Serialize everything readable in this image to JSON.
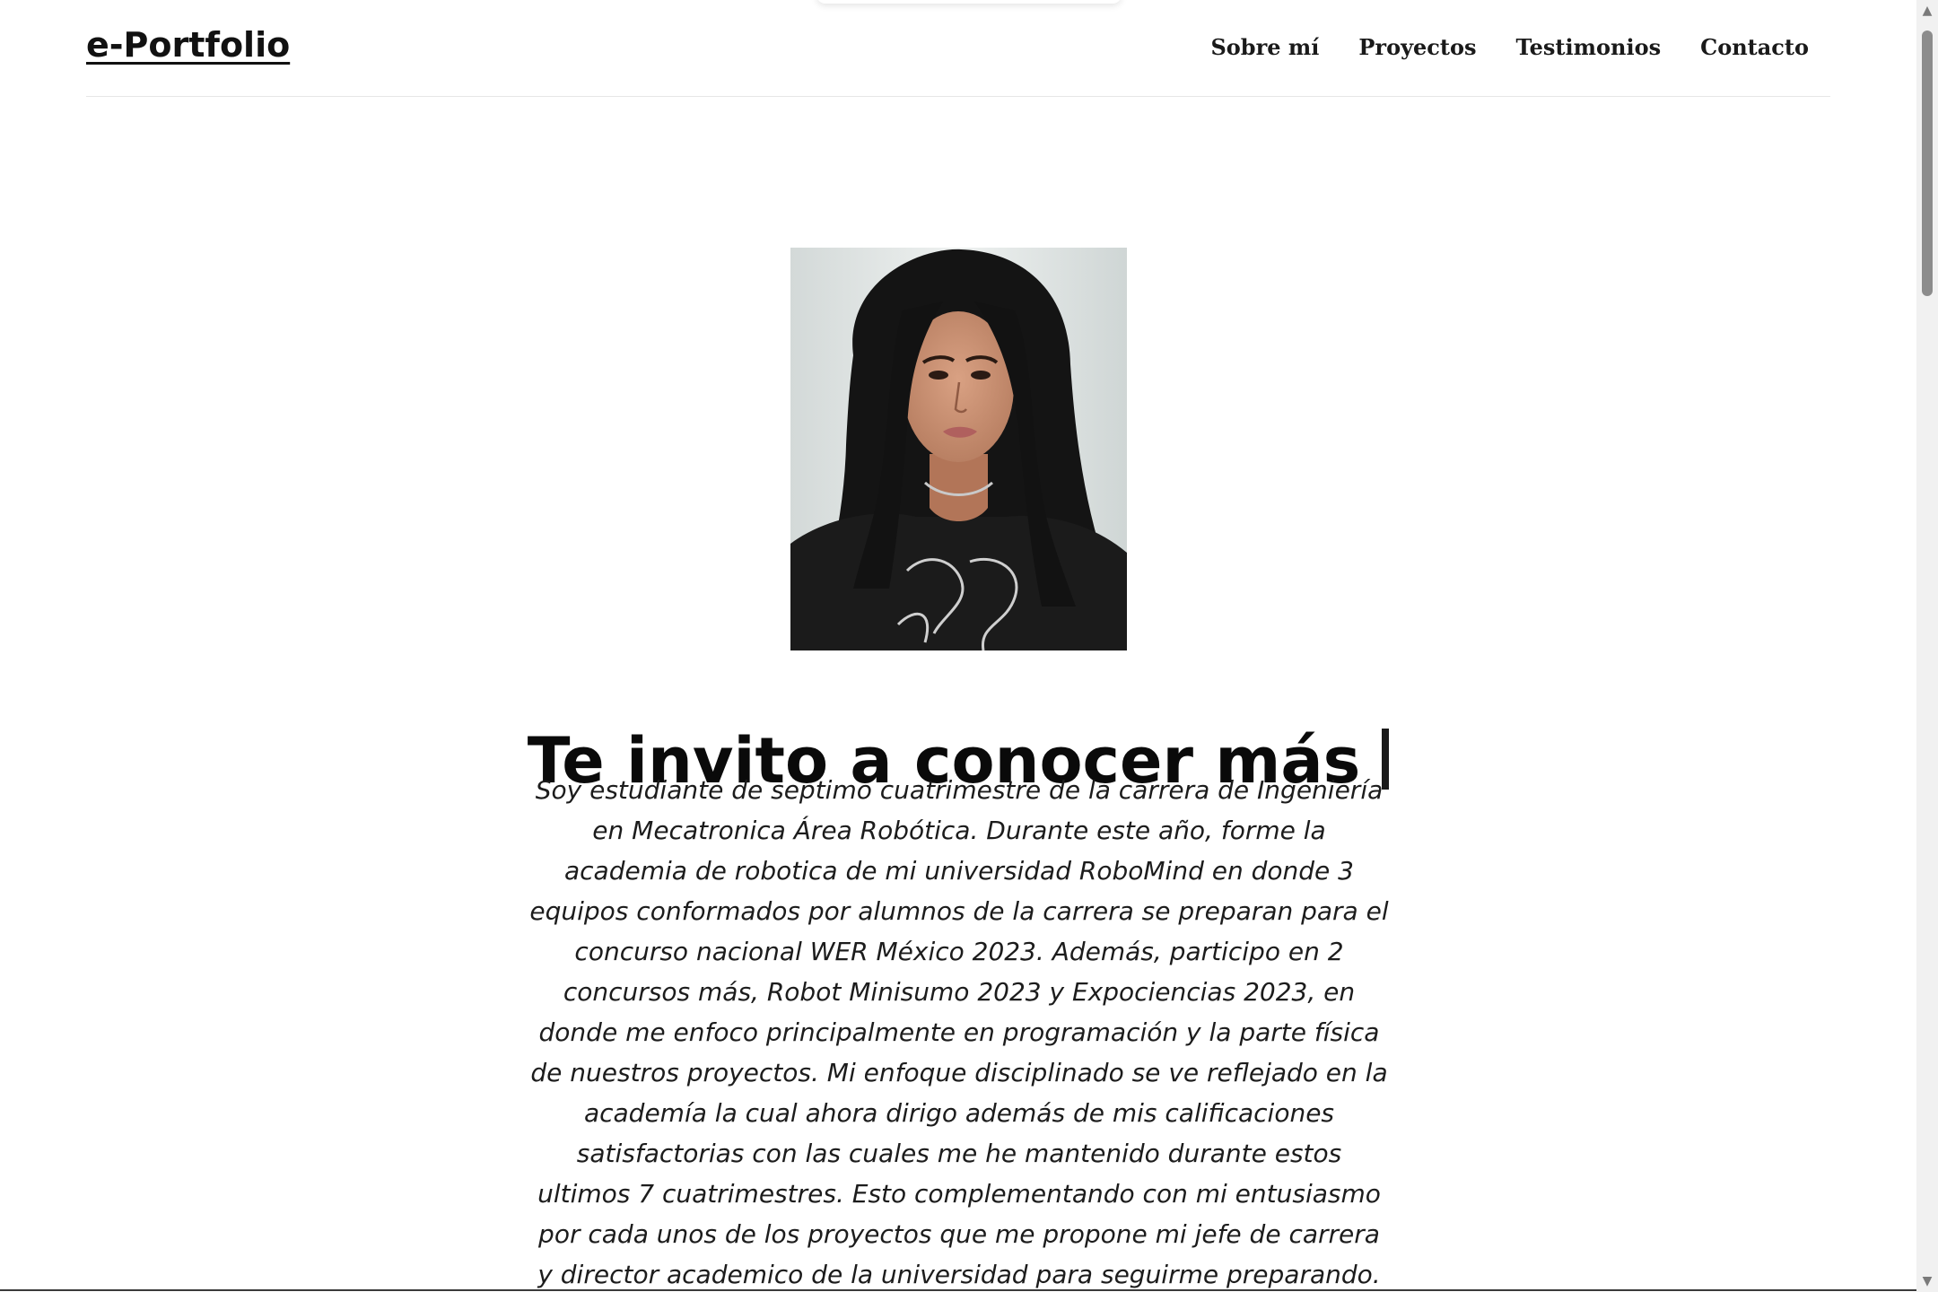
{
  "header": {
    "brand": "e-Portfolio",
    "nav": [
      {
        "label": "Sobre mí"
      },
      {
        "label": "Proyectos"
      },
      {
        "label": "Testimonios"
      },
      {
        "label": "Contacto"
      }
    ]
  },
  "hero": {
    "photo_icon": "profile-photo",
    "headline": "Te invito a conocer más",
    "bio": "Soy estudiante de septimo cuatrimestre de la carrera de Ingeniería en Mecatronica Área Robótica. Durante este año, forme la academia de robotica de mi universidad RoboMind en donde 3 equipos conformados por alumnos de la carrera se preparan para el concurso nacional WER México 2023. Además, participo en 2 concursos más, Robot Minisumo 2023 y Expociencias 2023, en donde me enfoco principalmente en programación y la parte física de nuestros proyectos. Mi enfoque disciplinado se ve reflejado en la academía la cual ahora dirigo además de mis calificaciones satisfactorias con las cuales me he mantenido durante estos ultimos 7 cuatrimestres. Esto complementando con mi entusiasmo por cada unos de los proyectos que me propone mi jefe de carrera y director academico de la universidad para seguirme preparando. Me considero una mujer apasionada en los campos de la"
  },
  "scrollbar": {
    "up_icon": "scroll-up-arrow-icon",
    "down_icon": "scroll-down-arrow-icon",
    "up_glyph": "▲",
    "down_glyph": "▼"
  },
  "colors": {
    "text": "#111111",
    "background": "#ffffff",
    "divider": "#e6e6e6",
    "scroll_thumb": "#8c8c8c"
  }
}
